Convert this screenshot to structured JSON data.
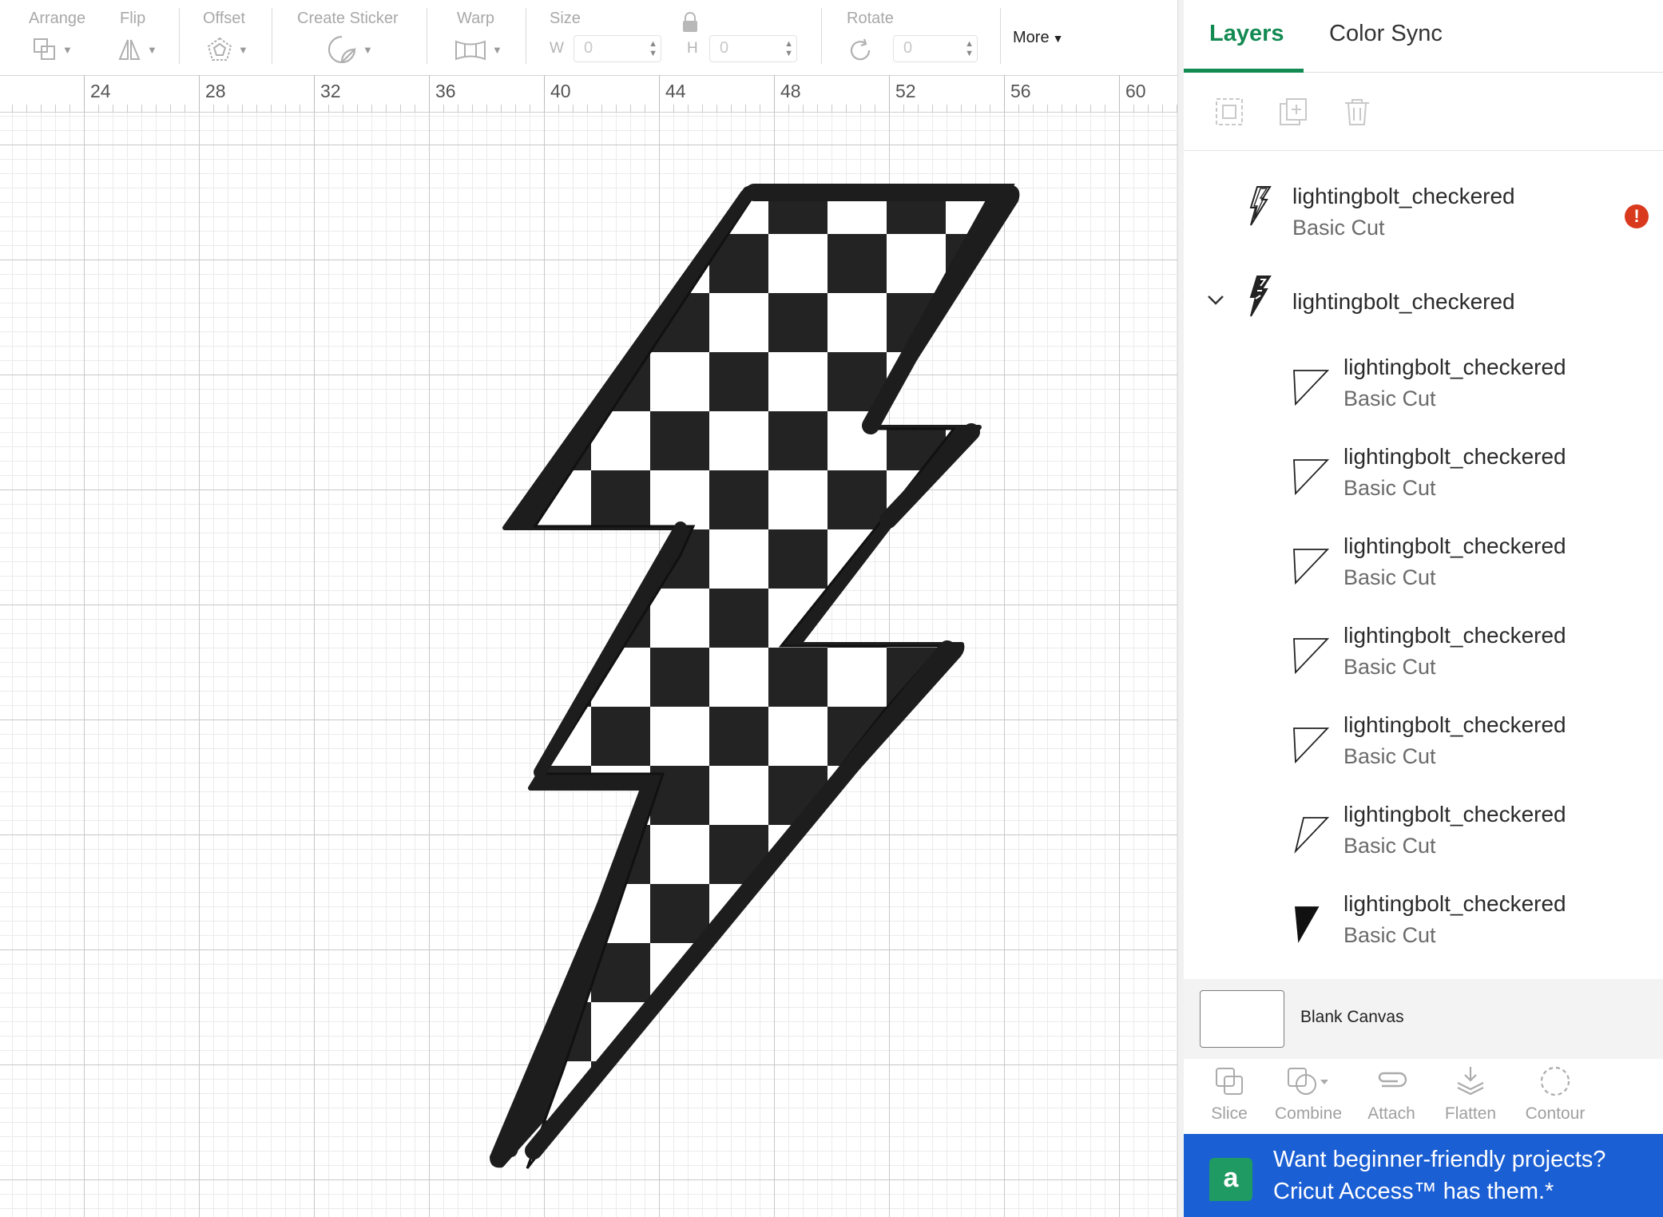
{
  "toolbar": {
    "arrange_label": "Arrange",
    "flip_label": "Flip",
    "offset_label": "Offset",
    "create_sticker_label": "Create Sticker",
    "warp_label": "Warp",
    "size_label": "Size",
    "width_letter": "W",
    "width_value": "0",
    "height_letter": "H",
    "height_value": "0",
    "rotate_label": "Rotate",
    "rotate_value": "0",
    "more_label": "More"
  },
  "ruler": {
    "labels": [
      "24",
      "28",
      "32",
      "36",
      "40",
      "44",
      "48",
      "52",
      "56",
      "60"
    ]
  },
  "canvas": {
    "design": "lightningbolt-checkered",
    "colors": {
      "fill_dark": "#232323",
      "fill_light": "#ffffff",
      "outline": "#1c1c1c"
    }
  },
  "panel": {
    "tabs": [
      "Layers",
      "Color Sync"
    ],
    "active_tab": "Layers",
    "layer_tools": [
      "group-icon",
      "duplicate-icon",
      "delete-icon"
    ],
    "top_layer": {
      "name": "lightingbolt_checkered",
      "operation": "Basic Cut",
      "warning": "!"
    },
    "group": {
      "name": "lightingbolt_checkered",
      "expanded": true
    },
    "children": [
      {
        "name": "lightingbolt_checkered",
        "operation": "Basic Cut"
      },
      {
        "name": "lightingbolt_checkered",
        "operation": "Basic Cut"
      },
      {
        "name": "lightingbolt_checkered",
        "operation": "Basic Cut"
      },
      {
        "name": "lightingbolt_checkered",
        "operation": "Basic Cut"
      },
      {
        "name": "lightingbolt_checkered",
        "operation": "Basic Cut"
      },
      {
        "name": "lightingbolt_checkered",
        "operation": "Basic Cut"
      },
      {
        "name": "lightingbolt_checkered",
        "operation": "Basic Cut"
      }
    ],
    "blank_canvas_label": "Blank Canvas",
    "bottom_tools": {
      "slice": "Slice",
      "combine": "Combine",
      "attach": "Attach",
      "flatten": "Flatten",
      "contour": "Contour"
    },
    "promo": {
      "logo": "a",
      "line1": "Want beginner-friendly projects?",
      "line2": "Cricut Access™ has them.*",
      "color": "#1b5fd4"
    },
    "accent_color": "#138a52",
    "warning_color": "#d93a1e"
  }
}
